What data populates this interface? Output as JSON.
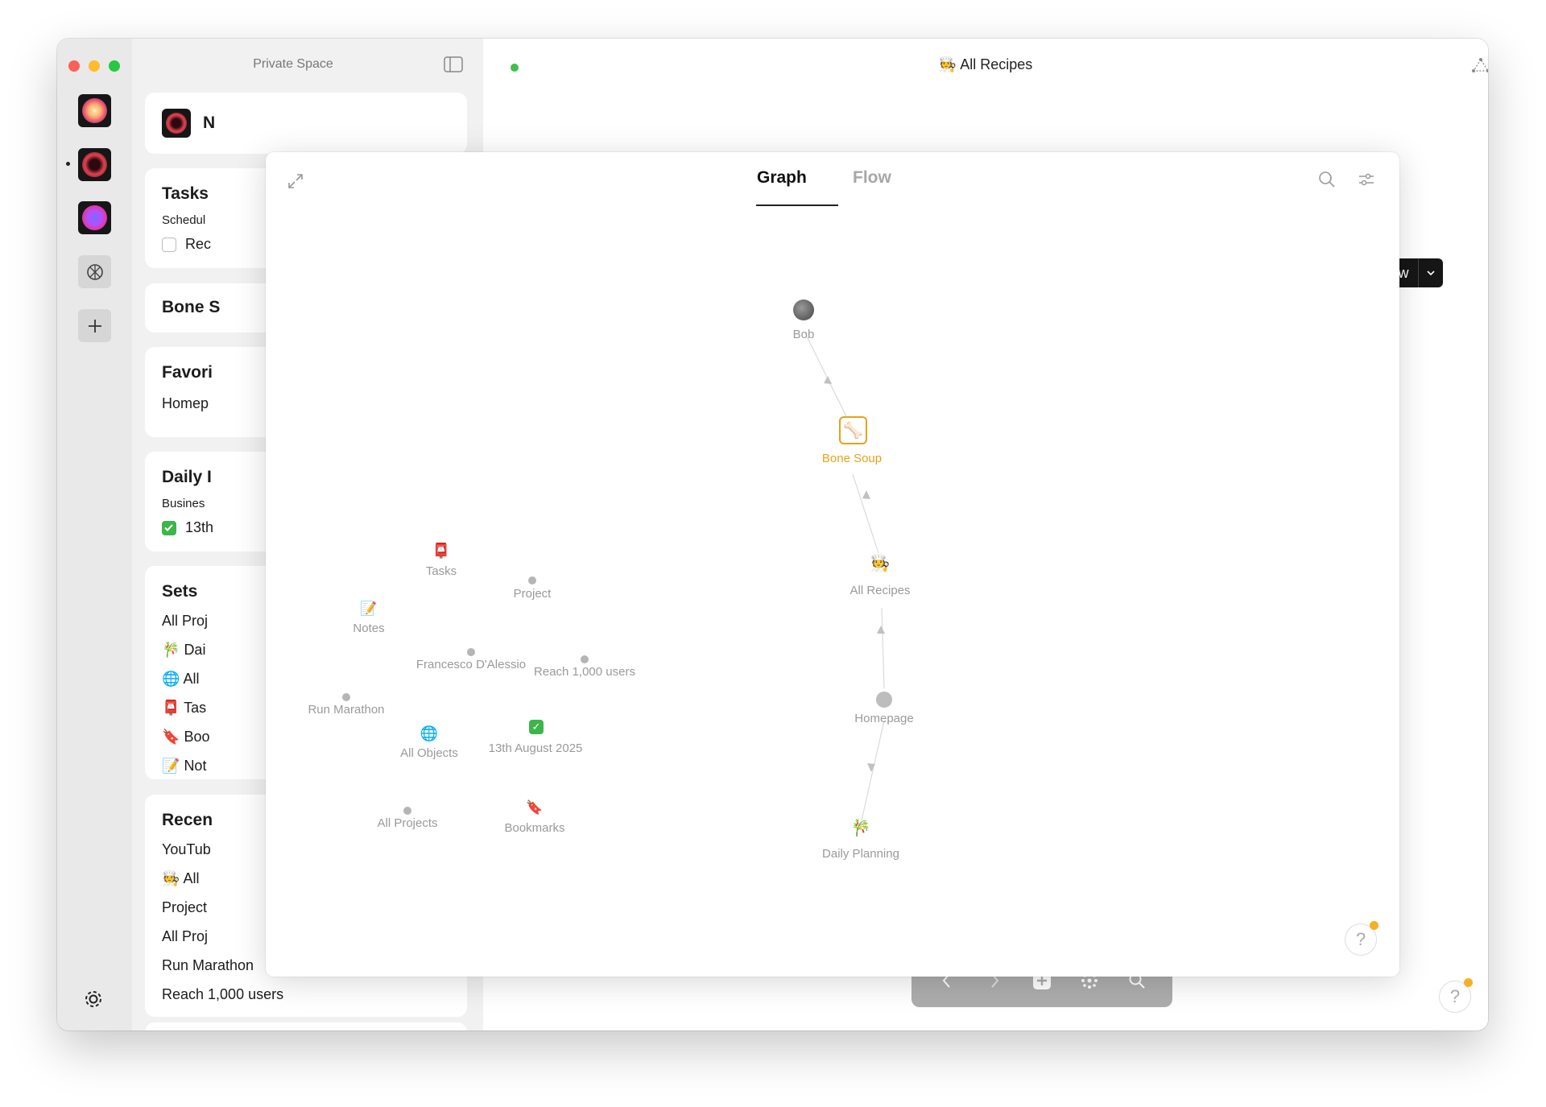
{
  "window": {
    "sidebar_title": "Private Space",
    "main_title": "All Recipes",
    "main_title_icon": "cook-emoji-icon"
  },
  "sidebar": {
    "widget_partial": "N",
    "tasks": {
      "title": "Tasks",
      "subtitle": "Schedul",
      "item": "Rec"
    },
    "bone": {
      "title": "Bone S"
    },
    "favorites": {
      "title": "Favori",
      "item": "Homep"
    },
    "daily": {
      "title": "Daily I",
      "subtitle": "Busines",
      "item": "13th"
    },
    "sets": {
      "title": "Sets",
      "items": [
        {
          "icon": "",
          "label": "All Proj"
        },
        {
          "icon": "🎋",
          "label": "Dai"
        },
        {
          "icon": "🌐",
          "label": "All"
        },
        {
          "icon": "📮",
          "label": "Tas"
        },
        {
          "icon": "🔖",
          "label": "Boo"
        },
        {
          "icon": "📝",
          "label": "Not"
        }
      ]
    },
    "recent": {
      "title": "Recen",
      "items": [
        {
          "icon": "",
          "label": "YouTub"
        },
        {
          "icon": "🧑‍🍳",
          "label": "All"
        },
        {
          "icon": "",
          "label": "Project"
        },
        {
          "icon": "",
          "label": "All Proj"
        },
        {
          "icon": "",
          "label": "Run Marathon"
        },
        {
          "icon": "",
          "label": "Reach 1,000 users"
        }
      ]
    }
  },
  "main": {
    "new_button": "New",
    "help": "?"
  },
  "graph_popup": {
    "tabs": [
      "Graph",
      "Flow"
    ],
    "active_tab": "Graph",
    "help": "?",
    "nodes": {
      "bob": "Bob",
      "bone_soup": "Bone Soup",
      "all_recipes": "All Recipes",
      "homepage": "Homepage",
      "daily_planning": "Daily Planning",
      "tasks": "Tasks",
      "project": "Project",
      "notes": "Notes",
      "francesco": "Francesco D'Alessio",
      "reach": "Reach 1,000 users",
      "run_marathon": "Run Marathon",
      "all_objects": "All Objects",
      "august": "13th August 2025",
      "all_projects": "All Projects",
      "bookmarks": "Bookmarks"
    },
    "node_icons": {
      "tasks": "📮",
      "notes": "📝",
      "all_objects": "🌐",
      "bookmarks": "🔖",
      "daily_planning": "🎋",
      "all_recipes": "🧑‍🍳",
      "bone_soup": "🦴",
      "august": "✓"
    },
    "accent_color": "#e8a21a"
  },
  "colors": {
    "accent": "#e8a21a",
    "status_green": "#3cc04a",
    "check_green": "#3cb64a",
    "notification": "#f5b026"
  }
}
